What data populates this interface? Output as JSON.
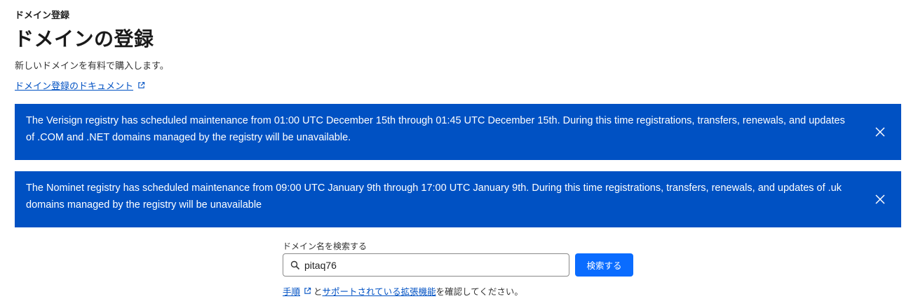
{
  "breadcrumb": "ドメイン登録",
  "title": "ドメインの登録",
  "subtitle": "新しいドメインを有料で購入します。",
  "doc_link": "ドメイン登録のドキュメント",
  "banners": [
    {
      "text": "The Verisign registry has scheduled maintenance from 01:00 UTC December 15th through 01:45 UTC December 15th. During this time registrations, transfers, renewals, and updates of .COM and .NET domains managed by the registry will be unavailable."
    },
    {
      "text": "The Nominet registry has scheduled maintenance from 09:00 UTC January 9th through 17:00 UTC January 9th. During this time registrations, transfers, renewals, and updates of .uk domains managed by the registry will be unavailable"
    }
  ],
  "search": {
    "label": "ドメイン名を検索する",
    "value": "pitaq76",
    "button": "検索する"
  },
  "help": {
    "link1": "手順",
    "mid": "と",
    "link2": "サポートされている拡張機能",
    "suffix": "を確認してください。"
  },
  "colors": {
    "banner_bg": "#0051c3",
    "button_bg": "#0a6cff",
    "link": "#0051c3"
  }
}
